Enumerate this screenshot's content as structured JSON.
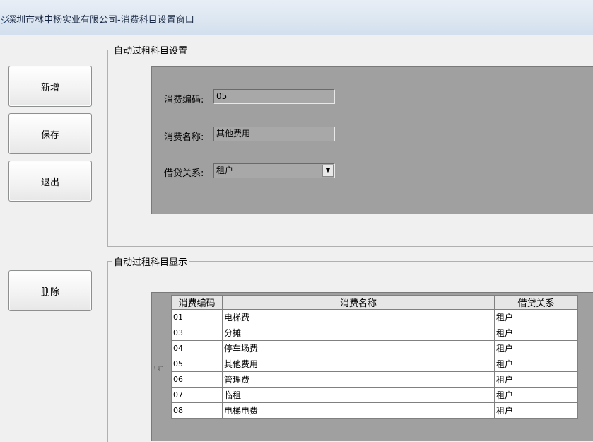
{
  "window": {
    "icon": "app-icon",
    "icon_glyph": "ジ",
    "title": "深圳市林中杨实业有限公司-消费科目设置窗口"
  },
  "sidebar": {
    "new_label": "新增",
    "save_label": "保存",
    "exit_label": "退出",
    "delete_label": "删除"
  },
  "settings_group": {
    "legend": "自动过租科目设置",
    "code_label": "消费编码:",
    "code_value": "05",
    "name_label": "消费名称:",
    "name_value": "其他费用",
    "relation_label": "借贷关系:",
    "relation_value": "租户",
    "dropdown_icon": "chevron-down-icon"
  },
  "display_group": {
    "legend": "自动过租科目显示",
    "columns": [
      "消费编码",
      "消费名称",
      "借贷关系"
    ],
    "rows": [
      {
        "code": "01",
        "name": "电梯费",
        "relation": "租户"
      },
      {
        "code": "03",
        "name": "分摊",
        "relation": "租户"
      },
      {
        "code": "04",
        "name": "停车场费",
        "relation": "租户"
      },
      {
        "code": "05",
        "name": "其他费用",
        "relation": "租户"
      },
      {
        "code": "06",
        "name": "管理费",
        "relation": "租户"
      },
      {
        "code": "07",
        "name": "临租",
        "relation": "租户"
      },
      {
        "code": "08",
        "name": "电梯电费",
        "relation": "租户"
      }
    ],
    "current_row_icon": "hand-pointer-icon",
    "current_row_glyph": "☞"
  },
  "colors": {
    "panel": "#a0a0a0",
    "titlebar": "#dce6f1"
  }
}
